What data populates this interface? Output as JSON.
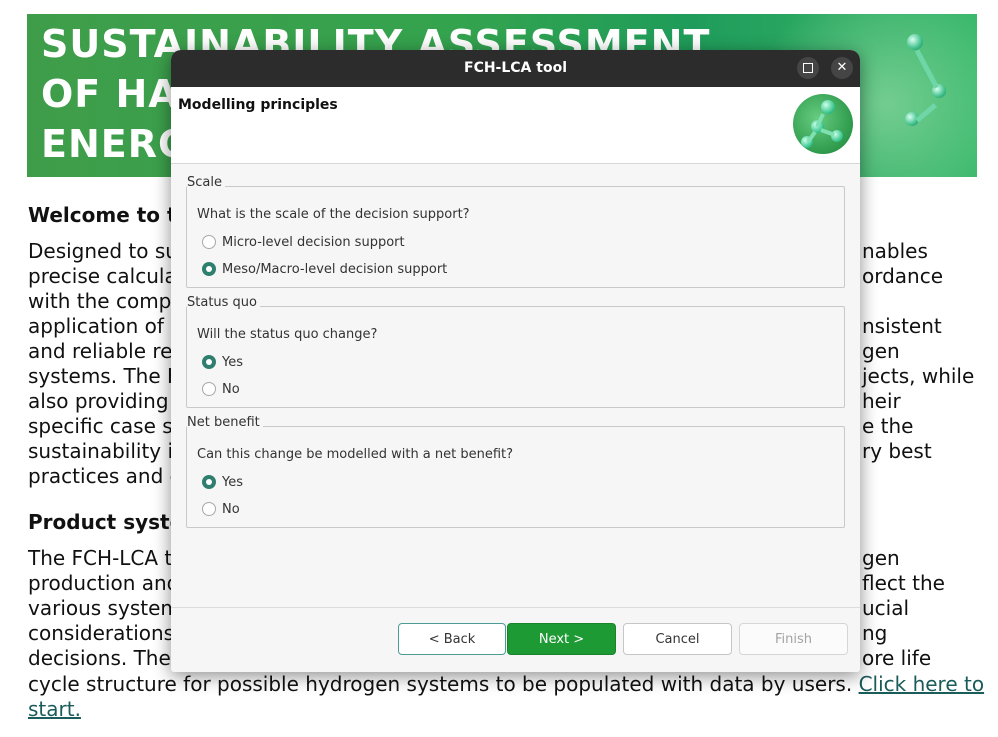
{
  "background_page": {
    "banner": {
      "line1": "SUSTAINABILITY ASSESSMENT",
      "line2": "OF HA",
      "line3": "ENERG"
    },
    "welcome_heading": "Welcome to th",
    "paragraph1_left": [
      "Designed to su",
      "precise calcula",
      "with the comp",
      "application of",
      "and reliable re",
      "systems. The F",
      "also providing",
      "specific case st",
      "sustainability i",
      "practices and e"
    ],
    "paragraph1_right": [
      "nables",
      "ordance",
      "",
      "nsistent",
      "gen",
      "jects, while",
      "heir",
      "e the",
      "ry best",
      ""
    ],
    "product_heading": "Product syste",
    "paragraph2_left": [
      "The FCH-LCA to",
      "production and",
      "various system",
      "considerations",
      "decisions. The"
    ],
    "paragraph2_right": [
      "gen",
      "flect the",
      "ucial",
      "ng",
      "ore life"
    ],
    "last_line_text": "cycle structure for possible hydrogen systems to be populated with data by users.",
    "link_part1": "Click here to",
    "link_part2": "start."
  },
  "dialog": {
    "title": "FCH-LCA tool",
    "header_title": "Modelling principles",
    "groups": [
      {
        "label": "Scale",
        "question": "What is the scale of the decision support?",
        "options": [
          {
            "label": "Micro-level decision support",
            "checked": false
          },
          {
            "label": "Meso/Macro-level decision support",
            "checked": true
          }
        ]
      },
      {
        "label": "Status quo",
        "question": "Will the status quo change?",
        "options": [
          {
            "label": "Yes",
            "checked": true
          },
          {
            "label": "No",
            "checked": false
          }
        ]
      },
      {
        "label": "Net benefit",
        "question": "Can this change be modelled with a net benefit?",
        "options": [
          {
            "label": "Yes",
            "checked": true
          },
          {
            "label": "No",
            "checked": false
          }
        ]
      }
    ],
    "buttons": {
      "back": "< Back",
      "next": "Next >",
      "cancel": "Cancel",
      "finish": "Finish"
    },
    "window_controls": {
      "maximize_icon": "maximize-icon",
      "close_icon": "close-icon",
      "close_glyph": "✕"
    }
  }
}
